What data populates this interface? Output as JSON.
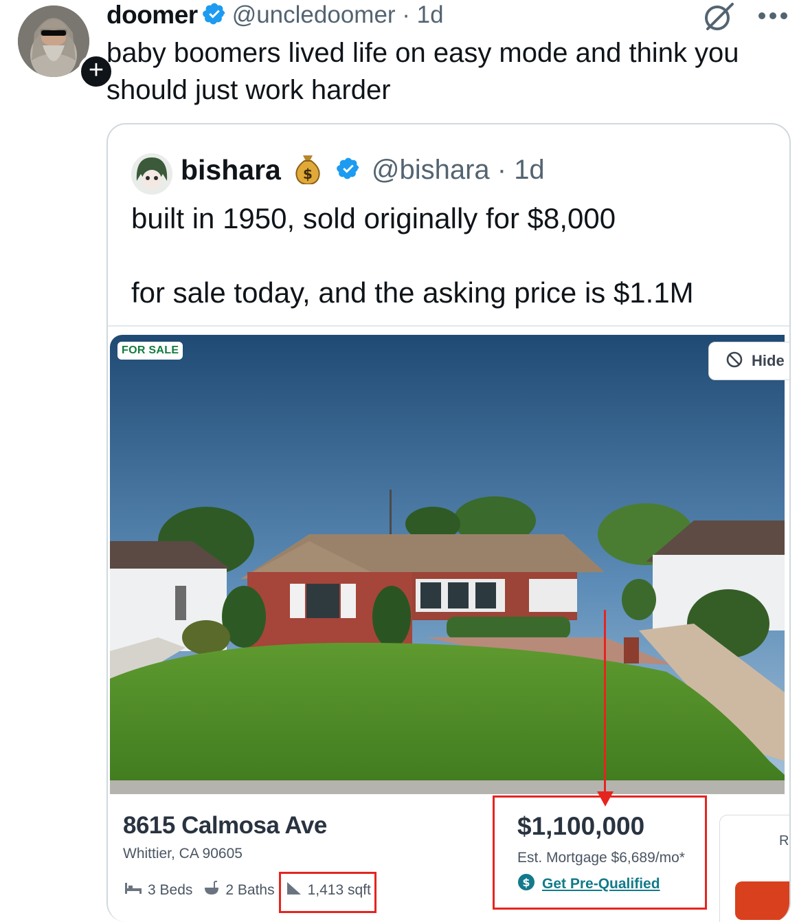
{
  "tweet": {
    "display_name": "doomer",
    "handle_time": "@uncledoomer · 1d",
    "text": "baby boomers lived life on easy mode and think you should just work harder"
  },
  "quote": {
    "display_name": "bishara",
    "handle_time": "@bishara · 1d",
    "text": "built in 1950, sold originally for $8,000\n\nfor sale today, and the asking price is $1.1M"
  },
  "listing": {
    "badge": "FOR SALE",
    "hide_label": "Hide",
    "address": "8615 Calmosa Ave",
    "city": "Whittier, CA 90605",
    "beds": "3 Beds",
    "baths": "2 Baths",
    "sqft": "1,413 sqft",
    "price": "$1,100,000",
    "mortgage": "Est. Mortgage $6,689/mo*",
    "prequal_label": "Get Pre-Qualified",
    "side_card_text": "Re"
  },
  "colors": {
    "verified": "#1d9bf0",
    "annotation_red": "#e52420",
    "badge_green": "#127a3e",
    "link_teal": "#127a8a"
  }
}
